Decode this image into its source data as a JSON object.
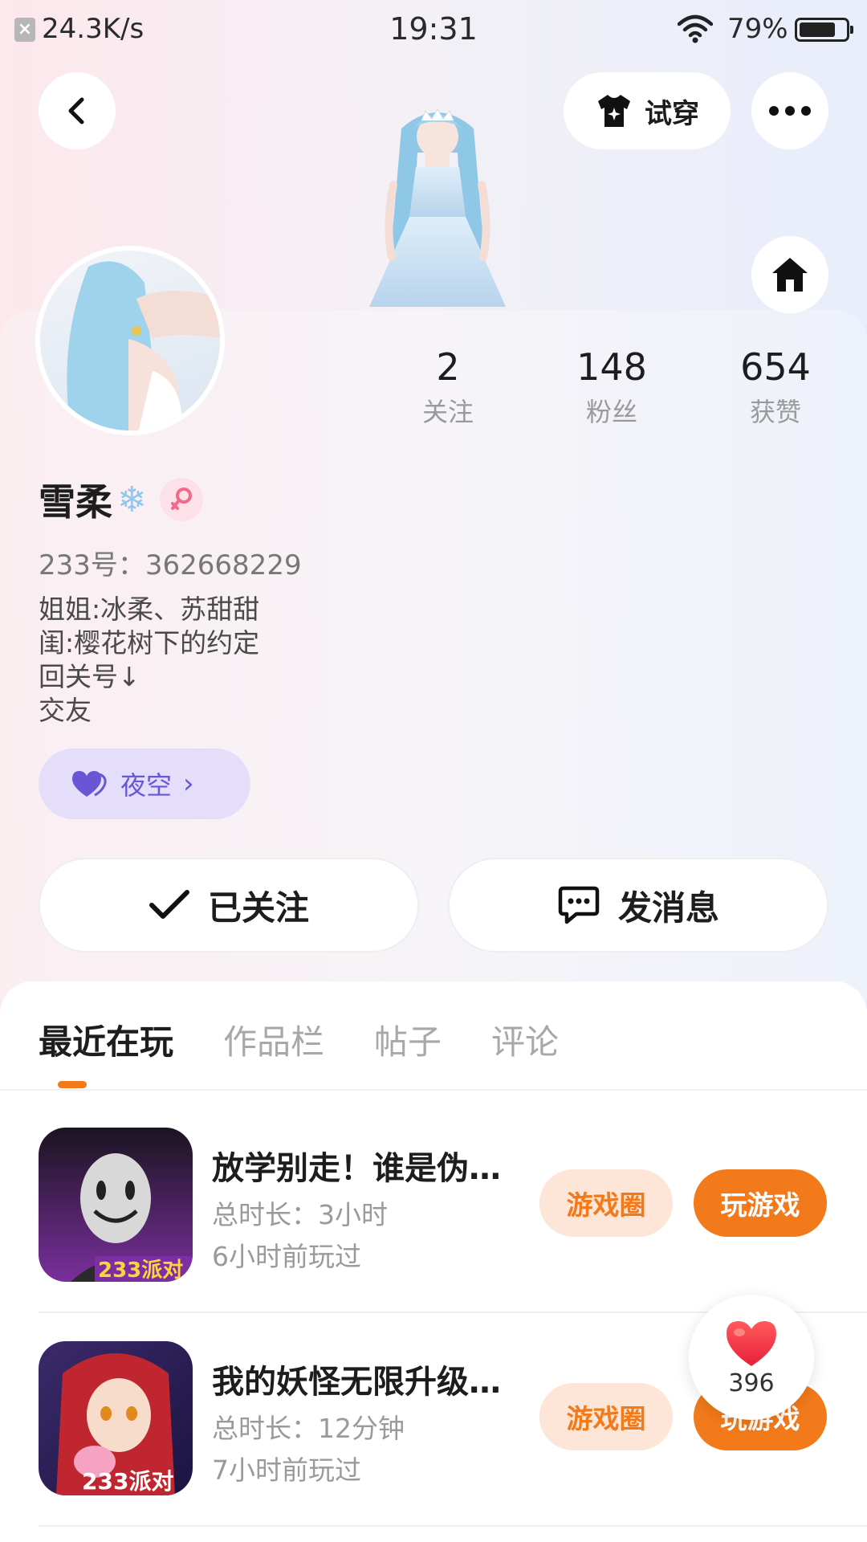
{
  "status_bar": {
    "net_speed": "24.3K/s",
    "time": "19:31",
    "battery_percent": "79%",
    "battery_level": 0.79
  },
  "top_bar": {
    "tryon_label": "试穿"
  },
  "profile": {
    "stats": [
      {
        "value": "2",
        "label": "关注"
      },
      {
        "value": "148",
        "label": "粉丝"
      },
      {
        "value": "654",
        "label": "获赞"
      }
    ],
    "username": "雪柔",
    "user_id": "233号：362668229",
    "bio": [
      "姐姐:冰柔、苏甜甜",
      "闺:樱花树下的约定",
      "回关号↓",
      "交友"
    ],
    "tag_label": "夜空",
    "followed_label": "已关注",
    "message_label": "发消息"
  },
  "tabs": [
    {
      "label": "最近在玩",
      "active": true
    },
    {
      "label": "作品栏",
      "active": false
    },
    {
      "label": "帖子",
      "active": false
    },
    {
      "label": "评论",
      "active": false
    }
  ],
  "games": [
    {
      "title": "放学别走！谁是伪…",
      "duration": "总时长：3小时",
      "last_played": "6小时前玩过",
      "icon_badge": "233派对",
      "circle_label": "游戏圈",
      "play_label": "玩游戏"
    },
    {
      "title": "我的妖怪无限升级…",
      "duration": "总时长：12分钟",
      "last_played": "7小时前玩过",
      "icon_badge": "233派对",
      "circle_label": "游戏圈",
      "play_label": "玩游戏"
    }
  ],
  "like_float": {
    "count": "396"
  },
  "colors": {
    "accent": "#f27a1a",
    "chip_bg": "#fde6d8",
    "tag_bg": "#e4defa",
    "tag_text": "#6a55d6"
  },
  "icons": [
    "back-arrow-icon",
    "tshirt-icon",
    "more-dots-icon",
    "home-icon",
    "snowflake-icon",
    "female-icon",
    "heart-icon",
    "check-icon",
    "chat-icon",
    "wifi-icon",
    "battery-icon"
  ]
}
